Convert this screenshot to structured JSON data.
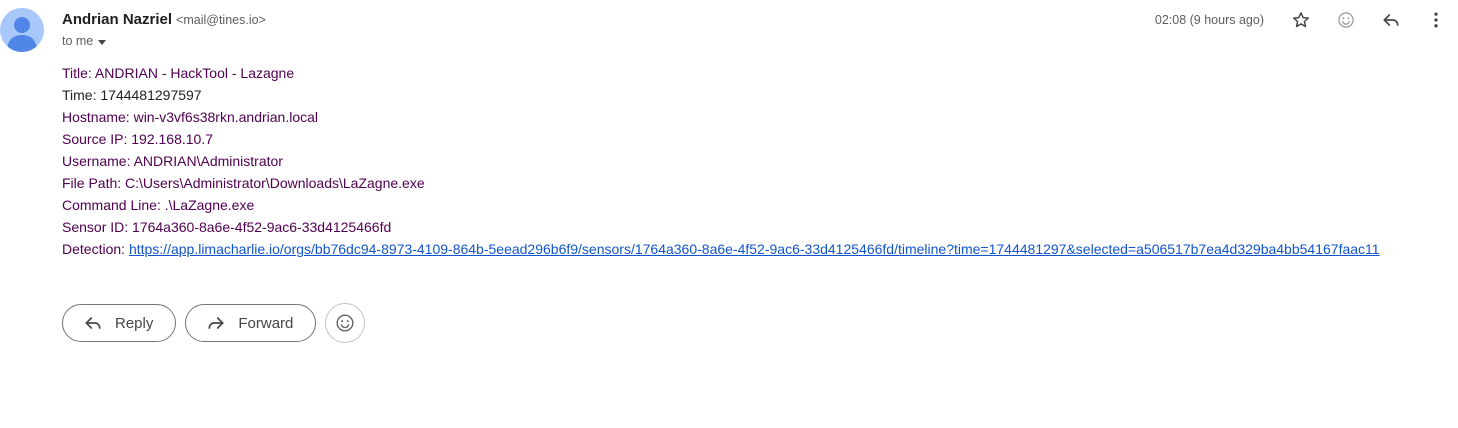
{
  "sender": {
    "name": "Andrian Nazriel",
    "email": "<mail@tines.io>",
    "recipient_label": "to me"
  },
  "header": {
    "timestamp": "02:08 (9 hours ago)",
    "icons": [
      "star-icon",
      "emoji-icon",
      "reply-icon",
      "more-vert-icon"
    ]
  },
  "body": {
    "title": "Title: ANDRIAN - HackTool - Lazagne",
    "time": "Time: 1744481297597",
    "hostname": "Hostname: win-v3vf6s38rkn.andrian.local",
    "source_ip": "Source IP: 192.168.10.7",
    "username": "Username: ANDRIAN\\Administrator",
    "file_path": "File Path: C:\\Users\\Administrator\\Downloads\\LaZagne.exe",
    "command_line": "Command Line: .\\LaZagne.exe",
    "sensor_id": "Sensor ID: 1764a360-8a6e-4f52-9ac6-33d4125466fd",
    "detection_label": "Detection: ",
    "detection_link": "https://app.limacharlie.io/orgs/bb76dc94-8973-4109-864b-5eead296b6f9/sensors/1764a360-8a6e-4f52-9ac6-33d4125466fd/timeline?time=1744481297&selected=a506517b7ea4d329ba4bb54167faac11"
  },
  "actions": {
    "reply_label": "Reply",
    "forward_label": "Forward"
  },
  "colors": {
    "avatar_bg": "#a8c7fa",
    "avatar_fg": "#4f86e8",
    "link": "#1155cc",
    "quoted_text": "#500050"
  }
}
